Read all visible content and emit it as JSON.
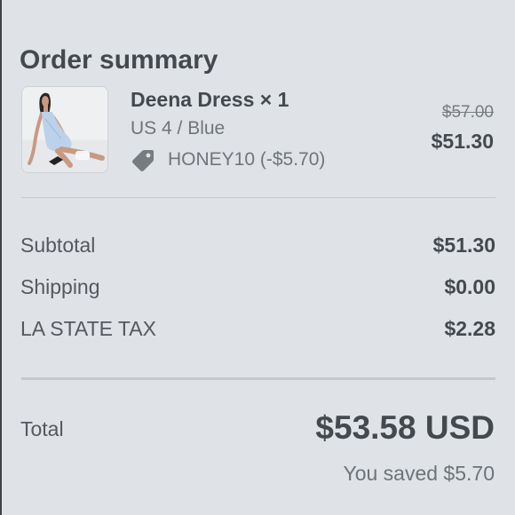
{
  "summary": {
    "title": "Order summary"
  },
  "item": {
    "name": "Deena Dress × 1",
    "variant": "US 4 / Blue",
    "discount": "HONEY10 (-$5.70)",
    "original_price": "$57.00",
    "price": "$51.30",
    "thumbnail_icon": "product-photo"
  },
  "lines": [
    {
      "label": "Subtotal",
      "value": "$51.30"
    },
    {
      "label": "Shipping",
      "value": "$0.00"
    },
    {
      "label": "LA STATE TAX",
      "value": "$2.28"
    }
  ],
  "total": {
    "label": "Total",
    "value": "$53.58 USD",
    "saved": "You saved $5.70"
  },
  "colors": {
    "background": "#dfe3e8",
    "text_primary": "#44494e",
    "text_secondary": "#70757a",
    "divider": "#c5c9ce"
  }
}
